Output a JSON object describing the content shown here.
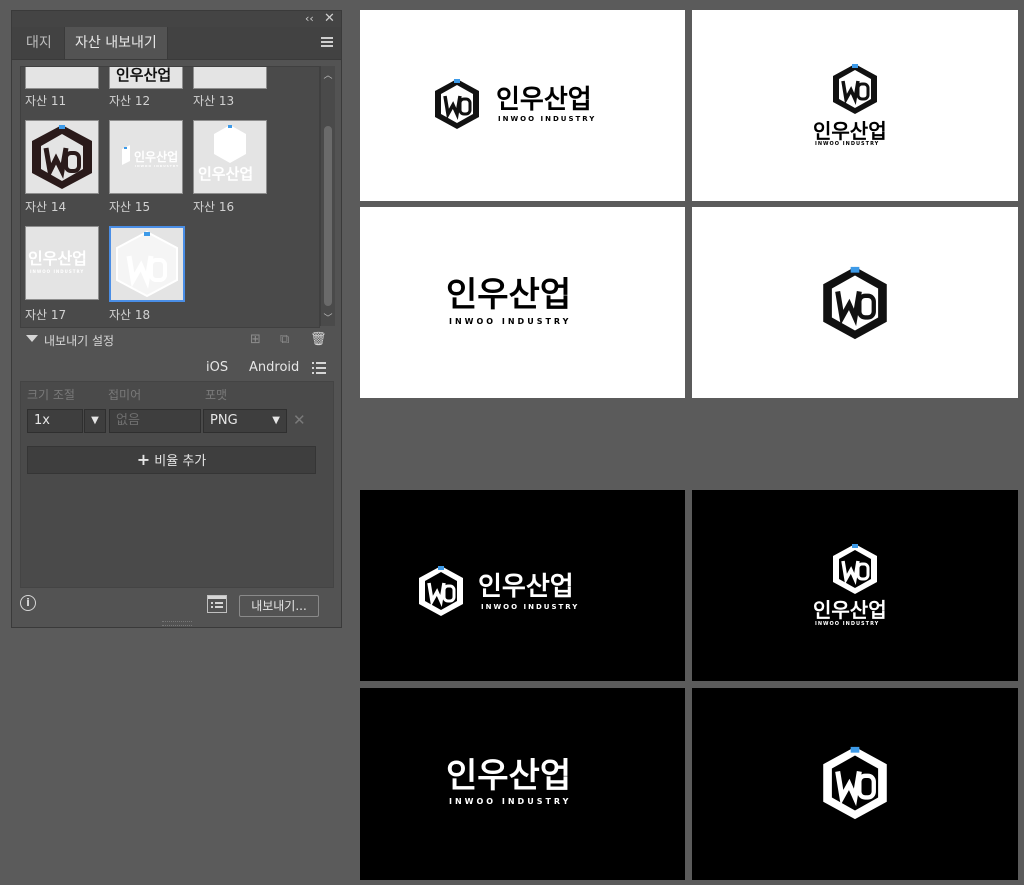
{
  "panel": {
    "tabs": [
      {
        "label": "대지"
      },
      {
        "label": "자산 내보내기"
      }
    ],
    "assets": [
      {
        "label": "자산 11"
      },
      {
        "label": "자산 12"
      },
      {
        "label": "자산 13"
      },
      {
        "label": "자산 14"
      },
      {
        "label": "자산 15"
      },
      {
        "label": "자산 16"
      },
      {
        "label": "자산 17"
      },
      {
        "label": "자산 18"
      }
    ],
    "section_title": "내보내기 설정",
    "platforms": {
      "ios": "iOS",
      "android": "Android"
    },
    "settings": {
      "headers": {
        "scale": "크기 조절",
        "suffix": "접미어",
        "format": "포맷"
      },
      "scale_value": "1x",
      "suffix_placeholder": "없음",
      "format_value": "PNG",
      "add_scale_label": "비율 추가"
    },
    "export_button": "내보내기..."
  },
  "artboards": {
    "logo_korean": "인우산업",
    "logo_english": "INWOO INDUSTRY"
  },
  "colors": {
    "accent": "#4a8ee6",
    "logo_blue": "#3d9ae8"
  }
}
